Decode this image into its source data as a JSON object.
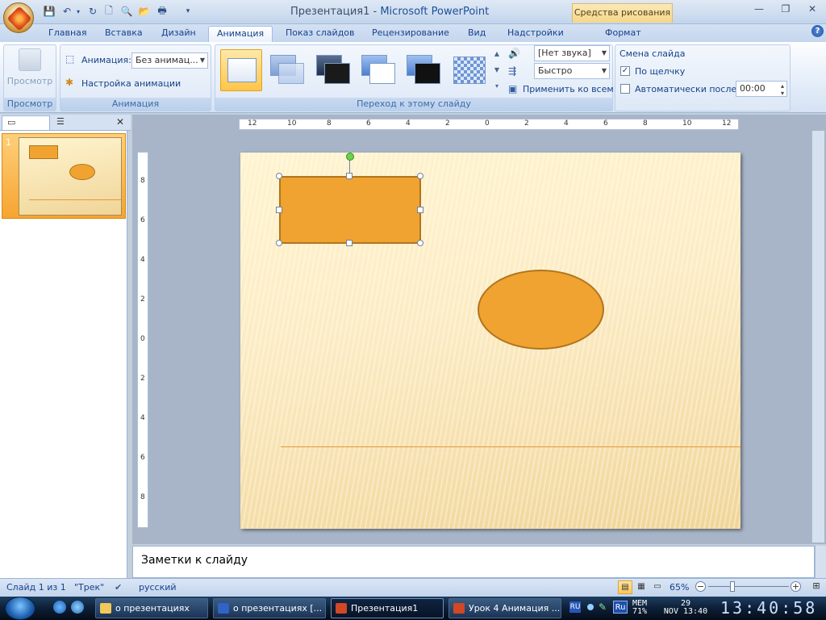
{
  "window": {
    "title_doc": "Презентация1",
    "title_sep": " - ",
    "title_app": "Microsoft PowerPoint",
    "contextual_tab": "Средства рисования"
  },
  "tabs": [
    "Главная",
    "Вставка",
    "Дизайн",
    "Анимация",
    "Показ слайдов",
    "Рецензирование",
    "Вид",
    "Надстройки",
    "Формат"
  ],
  "ribbon": {
    "preview_group": {
      "button": "Просмотр",
      "label": "Просмотр"
    },
    "animation_group": {
      "animation_label": "Анимация:",
      "animation_value": "Без анимац...",
      "custom_animation": "Настройка анимации",
      "label": "Анимация"
    },
    "transition_group": {
      "sound_value": "[Нет звука]",
      "speed_value": "Быстро",
      "apply_all": "Применить ко всем",
      "label": "Переход к этому слайду"
    },
    "advance_group": {
      "title": "Смена слайда",
      "on_click": "По щелчку",
      "on_click_checked": true,
      "auto_after": "Автоматически после:",
      "auto_after_checked": false,
      "time_value": "00:00"
    }
  },
  "slides_panel": {
    "slide_number": "1"
  },
  "ruler": {
    "h_labels": [
      "12",
      "10",
      "8",
      "6",
      "4",
      "2",
      "0",
      "2",
      "4",
      "6",
      "8",
      "10",
      "12"
    ],
    "v_labels": [
      "8",
      "6",
      "4",
      "2",
      "0",
      "2",
      "4",
      "6",
      "8"
    ]
  },
  "notes": {
    "placeholder": "Заметки к слайду"
  },
  "status": {
    "slide_info": "Слайд 1 из 1",
    "theme": "\"Трек\"",
    "language": "русский",
    "zoom": "65%"
  },
  "taskbar": {
    "items": [
      "о презентациях",
      "о презентациях [...",
      "Презентация1",
      "Урок 4 Анимация ..."
    ],
    "lang": "Ru",
    "mem_label": "MEM",
    "mem_value": "71%",
    "date_day": "29",
    "date_rest": "NOV 13:40",
    "clock": "13:40:58"
  },
  "colors": {
    "shape_fill": "#f0a330",
    "shape_border": "#b0751e",
    "accent": "#15428b"
  }
}
